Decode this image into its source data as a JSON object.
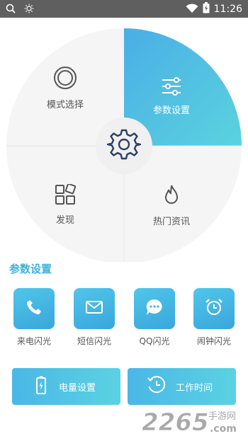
{
  "status_bar": {
    "time": "11:26"
  },
  "wheel": {
    "center_icon": "gear-icon",
    "segments": [
      {
        "label": "模式选择",
        "icon": "mode-ring-icon",
        "active": false
      },
      {
        "label": "参数设置",
        "icon": "sliders-icon",
        "active": true
      },
      {
        "label": "发现",
        "icon": "grid-icon",
        "active": false
      },
      {
        "label": "热门资讯",
        "icon": "flame-icon",
        "active": false
      }
    ]
  },
  "section": {
    "title": "参数设置"
  },
  "quick_actions": [
    {
      "label": "来电闪光",
      "icon": "phone-icon"
    },
    {
      "label": "短信闪光",
      "icon": "mail-icon"
    },
    {
      "label": "QQ闪光",
      "icon": "chat-bubble-icon"
    },
    {
      "label": "闹钟闪光",
      "icon": "alarm-clock-icon"
    }
  ],
  "bottom_buttons": [
    {
      "label": "电量设置",
      "icon": "battery-icon"
    },
    {
      "label": "工作时间",
      "icon": "clock-icon"
    }
  ],
  "watermark": {
    "brand": "2265",
    "site": "手游网",
    "domain": ".com"
  },
  "colors": {
    "accent": "#3fb1dd",
    "wheel_bg": "#f5f5f5"
  }
}
